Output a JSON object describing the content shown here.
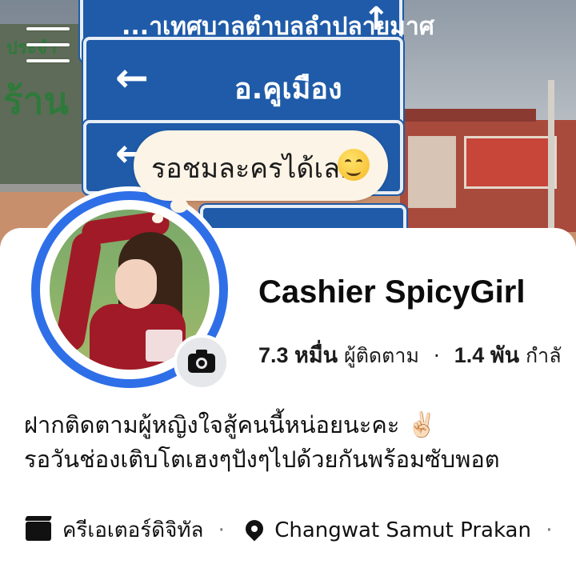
{
  "cover": {
    "signs": [
      {
        "text": "...าเทศบาลตำบลลำปลายมาศ",
        "arrow": "↑"
      },
      {
        "text": "อ.คูเมือง",
        "arrow": "←"
      },
      {
        "text": "",
        "arrow": "←"
      }
    ],
    "shop_text_1": "ประจำ",
    "shop_text_2": "ร้าน"
  },
  "menu": {
    "icon": "hamburger-menu-icon"
  },
  "status_bubble": {
    "text": "รอชมละครได้เลย",
    "emoji": "smiling-face-icon"
  },
  "profile": {
    "name": "Cashier SpicyGirl",
    "followers_value": "7.3 หมื่น",
    "followers_label": "ผู้ติดตาม",
    "following_value": "1.4 พัน",
    "following_label": "กำลั",
    "separator": "·"
  },
  "bio": {
    "line1": "ฝากติดตามผู้หญิงใจสู้คนนี้หน่อยนะคะ",
    "line1_emoji": "✌🏻",
    "line2": "รอวันช่องเติบโตเฮงๆปังๆไปด้วยกันพร้อมซับพอต"
  },
  "details": {
    "category": "ครีเอเตอร์ดิจิทัล",
    "location": "Changwat Samut Prakan",
    "separator": "·"
  },
  "colors": {
    "accent_ring": "#2e6fe8",
    "bubble_bg": "#fcf4e6",
    "sign_blue": "#1f5ba8"
  }
}
